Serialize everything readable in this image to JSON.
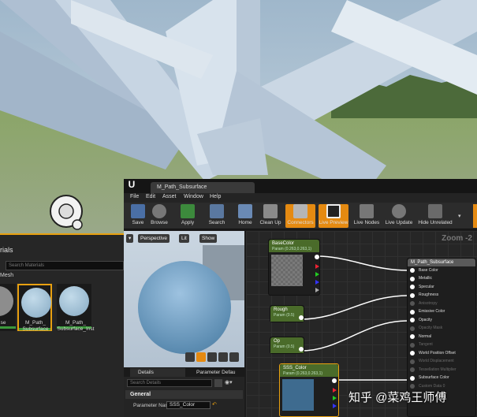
{
  "browser": {
    "header": "rials",
    "search_placeholder": "Search Materials",
    "folder": "Mesh",
    "assets": [
      {
        "name": "se",
        "color": "#8d8d8d"
      },
      {
        "name": "M_Path_\nSubsurface",
        "color": "#9cbfd7",
        "selected": true
      },
      {
        "name": "M_Path_\nSubsurface_Inst",
        "color": "#9cbfd7"
      }
    ]
  },
  "editor": {
    "tab_title": "M_Path_Subsurface",
    "menu": [
      "File",
      "Edit",
      "Asset",
      "Window",
      "Help"
    ],
    "toolbar": [
      {
        "label": "Save",
        "icon": "save-icon",
        "active": false
      },
      {
        "label": "Browse",
        "icon": "browse-icon",
        "active": false
      },
      {
        "label": "Apply",
        "icon": "apply-icon",
        "active": false
      },
      {
        "label": "Search",
        "icon": "search-icon",
        "active": false
      },
      {
        "label": "Home",
        "icon": "home-icon",
        "active": false
      },
      {
        "label": "Clean Up",
        "icon": "clean-up-icon",
        "active": false
      },
      {
        "label": "Connectors",
        "icon": "connectors-icon",
        "active": true
      },
      {
        "label": "Live Preview",
        "icon": "live-preview-icon",
        "active": true
      },
      {
        "label": "Live Nodes",
        "icon": "live-nodes-icon",
        "active": false
      },
      {
        "label": "Live Update",
        "icon": "live-update-icon",
        "active": false
      },
      {
        "label": "Hide Unrelated",
        "icon": "hide-unrelated-icon",
        "active": false
      }
    ],
    "viewport": {
      "perspective": "Perspective",
      "lit": "Lit",
      "show": "Show"
    },
    "details": {
      "tab_details": "Details",
      "tab_params": "Parameter Defau",
      "search_placeholder": "Search Details",
      "category": "General",
      "param_label": "Parameter Nam",
      "param_value": "SSS_Color"
    },
    "graph": {
      "zoom": "Zoom -2",
      "nodes": {
        "basecolor": {
          "title": "BaseColor",
          "sub": "Param (0.263,0.263,1)"
        },
        "rough": {
          "title": "Rough",
          "sub": "Param (0.5)"
        },
        "op": {
          "title": "Op",
          "sub": "Param (0.5)"
        },
        "sss": {
          "title": "SSS_Color",
          "sub": "Param (0.263,0.263,1)"
        },
        "output": {
          "title": "M_Path_Subsurface",
          "inputs": [
            {
              "label": "Base Color",
              "active": true
            },
            {
              "label": "Metallic",
              "active": true
            },
            {
              "label": "Specular",
              "active": true
            },
            {
              "label": "Roughness",
              "active": true
            },
            {
              "label": "Anisotropy",
              "active": false
            },
            {
              "label": "Emissive Color",
              "active": true
            },
            {
              "label": "Opacity",
              "active": true
            },
            {
              "label": "Opacity Mask",
              "active": false
            },
            {
              "label": "Normal",
              "active": true
            },
            {
              "label": "Tangent",
              "active": false
            },
            {
              "label": "World Position Offset",
              "active": true
            },
            {
              "label": "World Displacement",
              "active": false
            },
            {
              "label": "Tessellation Multiplier",
              "active": false
            },
            {
              "label": "Subsurface Color",
              "active": true
            },
            {
              "label": "Custom Data 0",
              "active": false
            }
          ]
        }
      }
    }
  },
  "watermark": "知乎 @菜鸡王师傅",
  "colors": {
    "accent": "#e58a11",
    "param_node": "#4a6b2a",
    "output_node": "#5a5a5a"
  }
}
